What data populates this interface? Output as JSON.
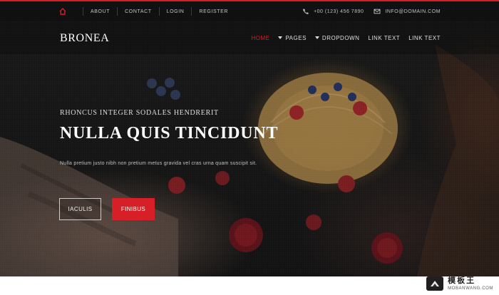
{
  "utility_bar": {
    "links": [
      "ABOUT",
      "CONTACT",
      "LOGIN",
      "REGISTER"
    ],
    "phone": "+00 (123) 456 7890",
    "email": "INFO@DOMAIN.COM"
  },
  "brand": {
    "name": "BRONEA"
  },
  "nav": {
    "items": [
      "HOME",
      "PAGES",
      "DROPDOWN",
      "LINK TEXT",
      "LINK TEXT"
    ]
  },
  "hero": {
    "subtitle": "RHONCUS INTEGER SODALES HENDRERIT",
    "title": "NULLA QUIS TINCIDUNT",
    "description": "Nulla pretium justo nibh non pretium metus gravida vel cras urna quam suscipit sit.",
    "primary_button": "FINIBUS",
    "secondary_button": "IACULIS"
  },
  "watermark": {
    "text_cn": "模板王",
    "domain": "MOBANWANG.COM"
  },
  "colors": {
    "accent": "#d61f26",
    "topbar": "#121212",
    "text_light": "#ffffff"
  },
  "icons": {
    "home": "home-icon",
    "phone": "phone-icon",
    "email": "email-icon",
    "dropdown": "caret-down-icon"
  }
}
